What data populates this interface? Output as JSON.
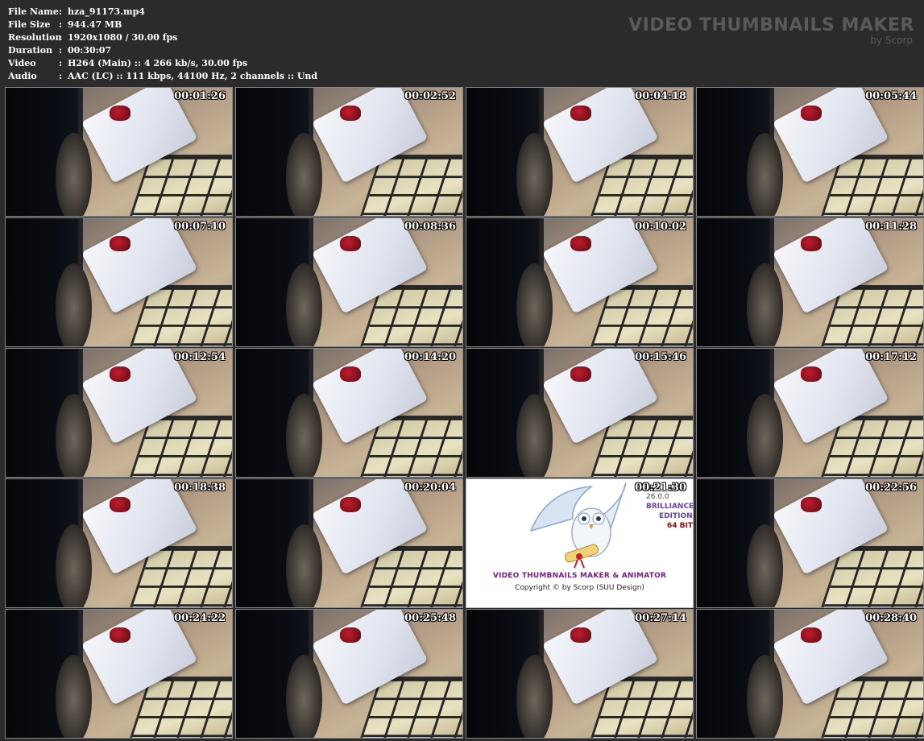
{
  "file_info": [
    {
      "key": "File Name",
      "value": "hza_91173.mp4"
    },
    {
      "key": "File Size",
      "value": "944.47 MB"
    },
    {
      "key": "Resolution",
      "value": "1920x1080 / 30.00 fps"
    },
    {
      "key": "Duration",
      "value": "00:30:07"
    },
    {
      "key": "Video",
      "value": "H264 (Main) :: 4 266 kb/s, 30.00 fps"
    },
    {
      "key": "Audio",
      "value": "AAC (LC) :: 111 kbps, 44100 Hz, 2 channels :: Und"
    }
  ],
  "separator": ":",
  "brand": {
    "title": "VIDEO THUMBNAILS MAKER",
    "subtitle": "by Scorp"
  },
  "thumbnails": [
    {
      "timestamp": "00:01:26"
    },
    {
      "timestamp": "00:02:52"
    },
    {
      "timestamp": "00:04:18"
    },
    {
      "timestamp": "00:05:44"
    },
    {
      "timestamp": "00:07:10"
    },
    {
      "timestamp": "00:08:36"
    },
    {
      "timestamp": "00:10:02"
    },
    {
      "timestamp": "00:11:28"
    },
    {
      "timestamp": "00:12:54"
    },
    {
      "timestamp": "00:14:20"
    },
    {
      "timestamp": "00:15:46"
    },
    {
      "timestamp": "00:17:12"
    },
    {
      "timestamp": "00:18:38"
    },
    {
      "timestamp": "00:20:04"
    },
    {
      "timestamp": "00:21:30"
    },
    {
      "timestamp": "00:22:56"
    },
    {
      "timestamp": "00:24:22"
    },
    {
      "timestamp": "00:25:48"
    },
    {
      "timestamp": "00:27:14"
    },
    {
      "timestamp": "00:28:40"
    }
  ],
  "logo_card": {
    "index": 14,
    "version": "26.0.0",
    "brilliance": "BRILLIANCE",
    "edition": "EDITION",
    "bit": "64 BIT",
    "product": "VIDEO THUMBNAILS MAKER & ANIMATOR",
    "copyright": "Copyright © by Scorp (SUU Design)"
  },
  "colors": {
    "background": "#2b2b2b",
    "text": "#ffffff",
    "brand": "#5a5a5a",
    "product_purple": "#7a1c8c",
    "bag_red": "#c21c2e"
  }
}
